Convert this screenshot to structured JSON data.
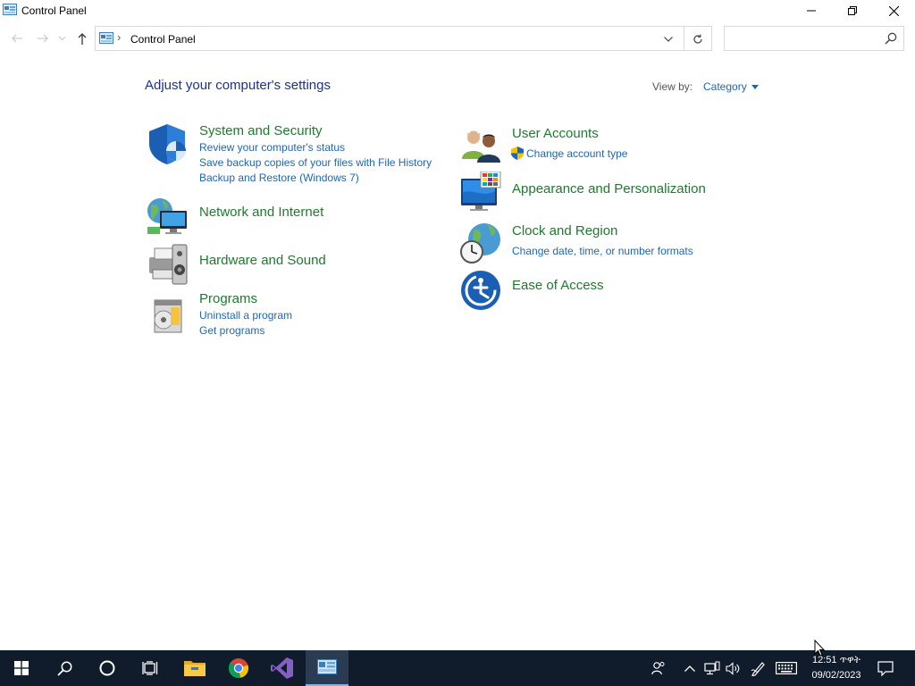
{
  "window": {
    "title": "Control Panel"
  },
  "address": {
    "path": "Control Panel",
    "separator": "›",
    "search_placeholder": ""
  },
  "main": {
    "heading": "Adjust your computer's settings",
    "view_by_label": "View by:",
    "view_by_value": "Category"
  },
  "categories": {
    "system_security": {
      "title": "System and Security",
      "links": [
        "Review your computer's status",
        "Save backup copies of your files with File History",
        "Backup and Restore (Windows 7)"
      ]
    },
    "network": {
      "title": "Network and Internet"
    },
    "hardware": {
      "title": "Hardware and Sound"
    },
    "programs": {
      "title": "Programs",
      "links": [
        "Uninstall a program",
        "Get programs"
      ]
    },
    "user_accounts": {
      "title": "User Accounts",
      "links": [
        "Change account type"
      ]
    },
    "appearance": {
      "title": "Appearance and Personalization"
    },
    "clock_region": {
      "title": "Clock and Region",
      "links": [
        "Change date, time, or number formats"
      ]
    },
    "ease": {
      "title": "Ease of Access"
    }
  },
  "taskbar": {
    "apps": [
      "start-icon",
      "search-icon",
      "cortana-icon",
      "task-view-icon",
      "file-explorer-icon",
      "chrome-icon",
      "visual-studio-icon",
      "control-panel-icon"
    ],
    "time": "12:51 ጥዋት",
    "date": "09/02/2023"
  },
  "colors": {
    "heading": "#1e3287",
    "category_title": "#1f7a2e",
    "link": "#1e66b4",
    "taskbar": "#101b2b"
  }
}
